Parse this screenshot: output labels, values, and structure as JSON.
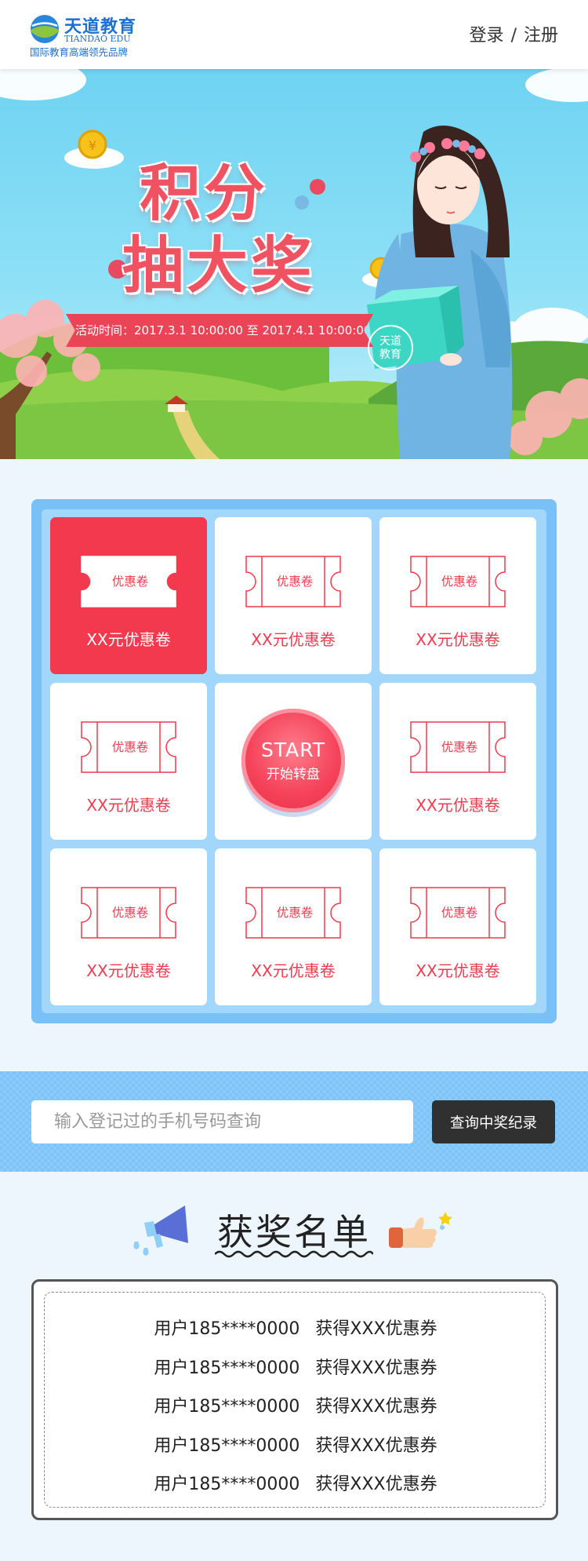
{
  "header": {
    "logo_cn": "天道教育",
    "logo_en": "TIANDAO EDU",
    "logo_slogan": "国际教育高端领先品牌",
    "login_label": "登录",
    "separator": "/",
    "register_label": "注册"
  },
  "banner": {
    "title_line1": "积分",
    "title_line2": "抽大奖",
    "activity_time": "活动时间：2017.3.1 10:00:00 至 2017.4.1 10:00:00",
    "box_label_line1": "天道",
    "box_label_line2": "教育"
  },
  "lottery": {
    "ticket_text": "优惠卷",
    "prize_label": "XX元优惠卷",
    "start_en": "START",
    "start_cn": "开始转盘",
    "active_index": 0
  },
  "query": {
    "placeholder": "输入登记过的手机号码查询",
    "button_label": "查询中奖纪录"
  },
  "winners": {
    "title": "获奖名单",
    "rows": [
      {
        "user": "用户185****0000",
        "prize": "获得XXX优惠券"
      },
      {
        "user": "用户185****0000",
        "prize": "获得XXX优惠券"
      },
      {
        "user": "用户185****0000",
        "prize": "获得XXX优惠券"
      },
      {
        "user": "用户185****0000",
        "prize": "获得XXX优惠券"
      },
      {
        "user": "用户185****0000",
        "prize": "获得XXX优惠券"
      }
    ]
  },
  "colors": {
    "brand_blue": "#1d6fd0",
    "accent_red": "#f2394d",
    "grid_blue": "#78c0f5",
    "button_dark": "#303030"
  },
  "icons": [
    "logo-icon",
    "coin-icon",
    "cloud-icon",
    "ticket-icon",
    "megaphone-icon",
    "thumbs-up-icon",
    "star-icon"
  ]
}
